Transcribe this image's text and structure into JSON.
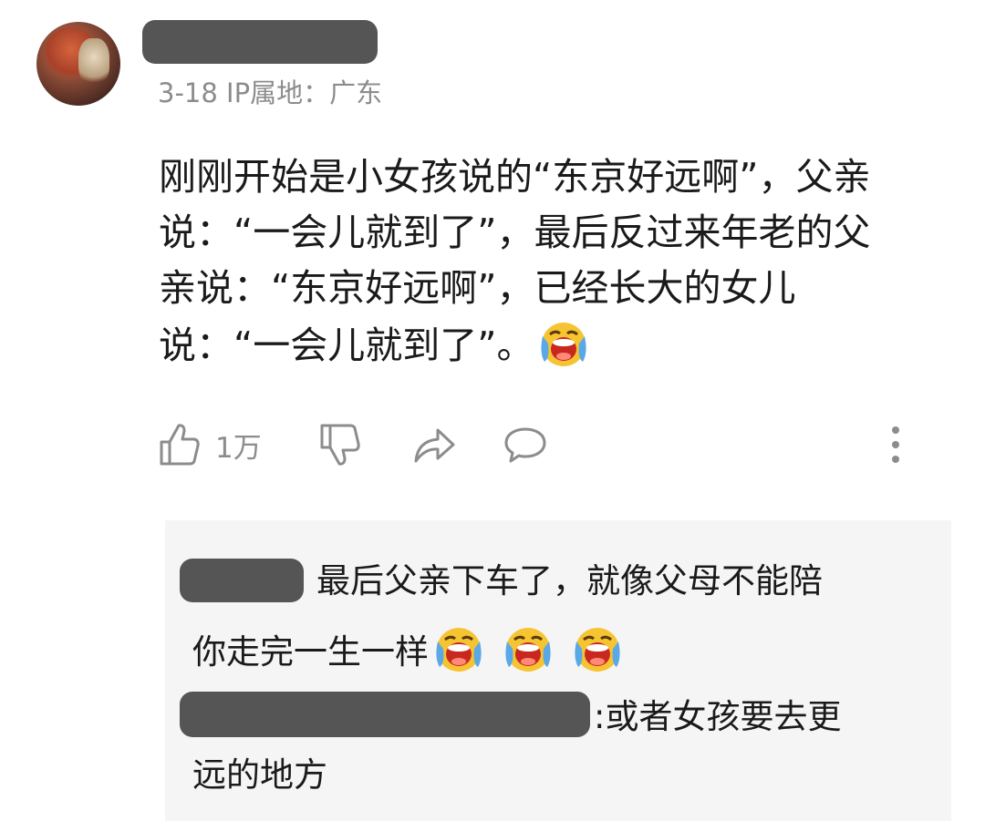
{
  "comment": {
    "meta": "3-18 IP属地：广东",
    "lines": [
      "刚刚开始是小女孩说的“东京好远啊”，父亲",
      "说：“一会儿就到了”，最后反过来年老的父",
      "亲说：“东京好远啊”，已经长大的女儿",
      "说：“一会儿就到了”。"
    ],
    "emoji_icon": "crying-face-emoji"
  },
  "actions": {
    "like_count": "1万",
    "like_icon": "thumbs-up-icon",
    "dislike_icon": "thumbs-down-icon",
    "share_icon": "share-arrow-icon",
    "reply_icon": "comment-bubble-icon",
    "more_icon": "vertical-dots-icon"
  },
  "replies": [
    {
      "line1": "最后父亲下车了，就像父母不能陪",
      "line2": "你走完一生一样"
    },
    {
      "line1": ":或者女孩要去更",
      "line2": "远的地方"
    }
  ],
  "colors": {
    "text": "#1a1a1a",
    "meta": "#8c8c8c",
    "redaction": "#555555",
    "reply_background": "#f5f5f5"
  }
}
